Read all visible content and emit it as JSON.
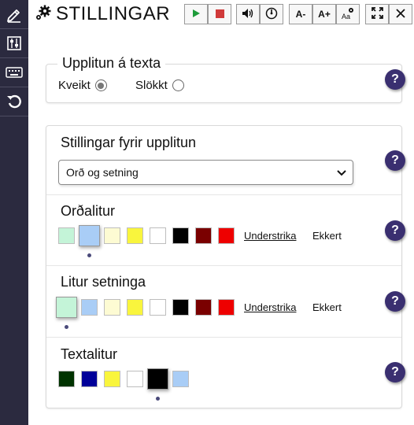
{
  "header": {
    "title": "STILLINGAR",
    "buttons": {
      "font_smaller": "A-",
      "font_larger": "A+"
    }
  },
  "sidebar": {
    "items": [
      "pen-icon",
      "sliders-icon",
      "keyboard-icon",
      "reset-icon"
    ]
  },
  "highlight_text": {
    "legend": "Upplitun á texta",
    "options": [
      {
        "label": "Kveikt",
        "checked": true
      },
      {
        "label": "Slökkt",
        "checked": false
      }
    ],
    "help": "?"
  },
  "highlight_settings": {
    "title": "Stillingar fyrir upplitun",
    "selected": "Orð og setning",
    "help": "?"
  },
  "word_color": {
    "title": "Orðalitur",
    "swatches": [
      "#c4f4d8",
      "#a9cdf6",
      "#fdfbd3",
      "#f9f53d",
      "#ffffff",
      "#000000",
      "#7a0000",
      "#ee0000"
    ],
    "selected_index": 1,
    "underline_label": "Understrika",
    "none_label": "Ekkert",
    "help": "?"
  },
  "sentence_color": {
    "title": "Litur setninga",
    "swatches": [
      "#c4f4d8",
      "#a9cdf6",
      "#fdfbd3",
      "#f9f53d",
      "#ffffff",
      "#000000",
      "#7a0000",
      "#ee0000"
    ],
    "selected_index": 0,
    "underline_label": "Understrika",
    "none_label": "Ekkert",
    "help": "?"
  },
  "text_color": {
    "title": "Textalitur",
    "swatches": [
      "#003300",
      "#000099",
      "#f9f53d",
      "#ffffff",
      "#000000",
      "#a9cdf6"
    ],
    "selected_index": 4,
    "help": "?"
  }
}
